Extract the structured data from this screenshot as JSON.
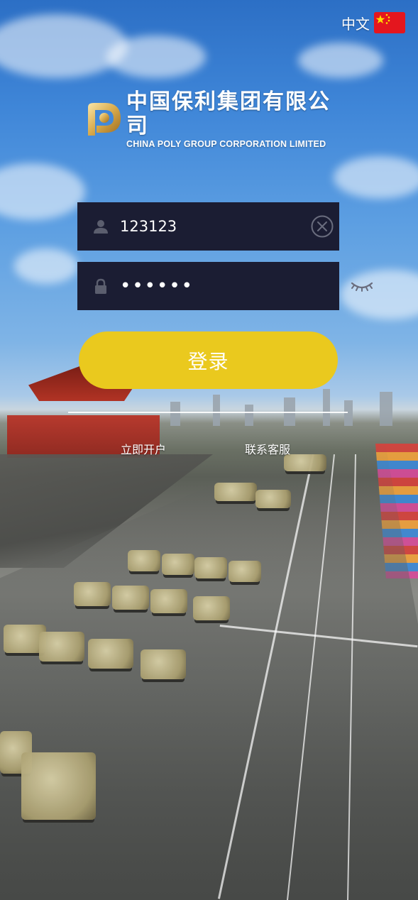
{
  "header": {
    "language_label": "中文",
    "flag_icon": "china-flag-icon"
  },
  "logo": {
    "name_cn": "中国保利集团有限公司",
    "name_en": "CHINA POLY GROUP CORPORATION LIMITED"
  },
  "login_form": {
    "username_value": "123123",
    "password_value": "••••••",
    "username_icon": "user-icon",
    "password_icon": "lock-icon",
    "clear_icon": "clear-circle-icon",
    "toggle_icon": "eye-closed-icon",
    "submit_label": "登录"
  },
  "links": {
    "register_label": "立即开户",
    "support_label": "联系客服"
  },
  "colors": {
    "accent": "#eac91e",
    "field_background": "#1b1d33",
    "text": "#ffffff"
  }
}
